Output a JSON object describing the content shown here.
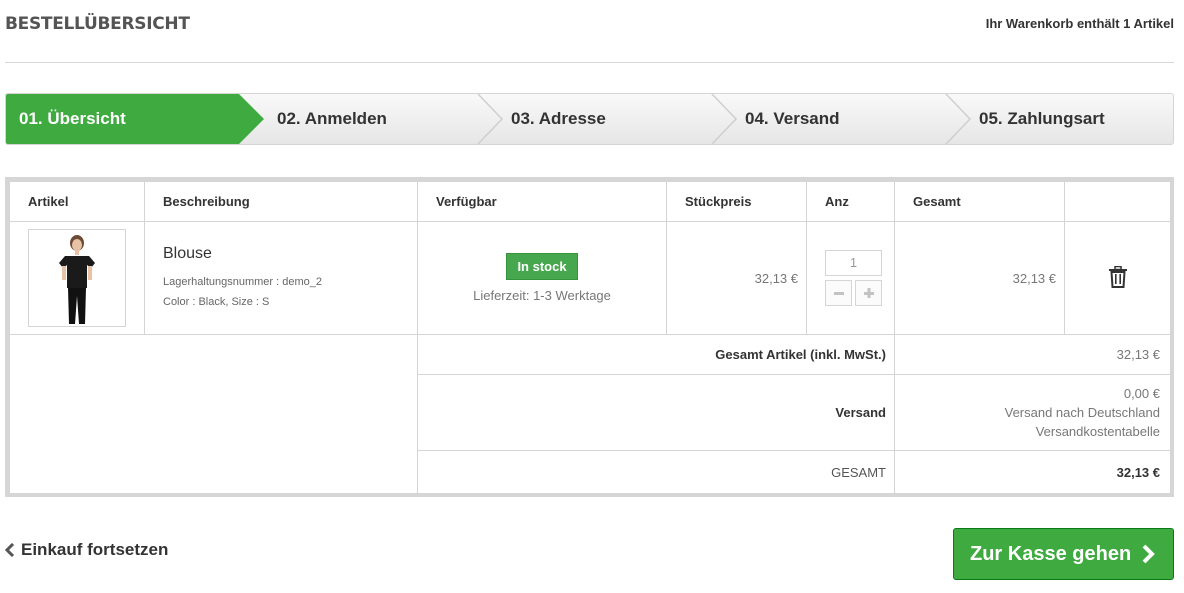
{
  "header": {
    "title": "BESTELLÜBERSICHT",
    "cart_count": "Ihr Warenkorb enthält 1 Artikel"
  },
  "steps": [
    {
      "label": "01. Übersicht",
      "active": true
    },
    {
      "label": "02. Anmelden",
      "active": false
    },
    {
      "label": "03. Adresse",
      "active": false
    },
    {
      "label": "04. Versand",
      "active": false
    },
    {
      "label": "05. Zahlungsart",
      "active": false
    }
  ],
  "table": {
    "columns": [
      "Artikel",
      "Beschreibung",
      "Verfügbar",
      "Stückpreis",
      "Anz",
      "Gesamt",
      ""
    ],
    "product": {
      "name": "Blouse",
      "sku": "Lagerhaltungsnummer : demo_2",
      "attributes": "Color : Black, Size : S",
      "stock": "In stock",
      "delivery": "Lieferzeit: 1-3 Werktage",
      "unit_price": "32,13 €",
      "quantity": "1",
      "total": "32,13 €",
      "minus_icon": "minus-icon",
      "plus_icon": "plus-icon",
      "delete_icon": "trash-icon"
    },
    "summary": {
      "items_label": "Gesamt Artikel (inkl. MwSt.)",
      "items_value": "32,13 €",
      "shipping_label": "Versand",
      "shipping_value": "0,00 €",
      "shipping_line2": "Versand nach Deutschland",
      "shipping_line3": "Versandkostentabelle",
      "total_label": "GESAMT",
      "total_value": "32,13 €"
    }
  },
  "actions": {
    "continue_label": "Einkauf fortsetzen",
    "checkout_label": "Zur Kasse gehen"
  },
  "colors": {
    "accent_green": "#3eaa3f",
    "stock_green": "#46a74e",
    "border": "#d6d6d6"
  }
}
